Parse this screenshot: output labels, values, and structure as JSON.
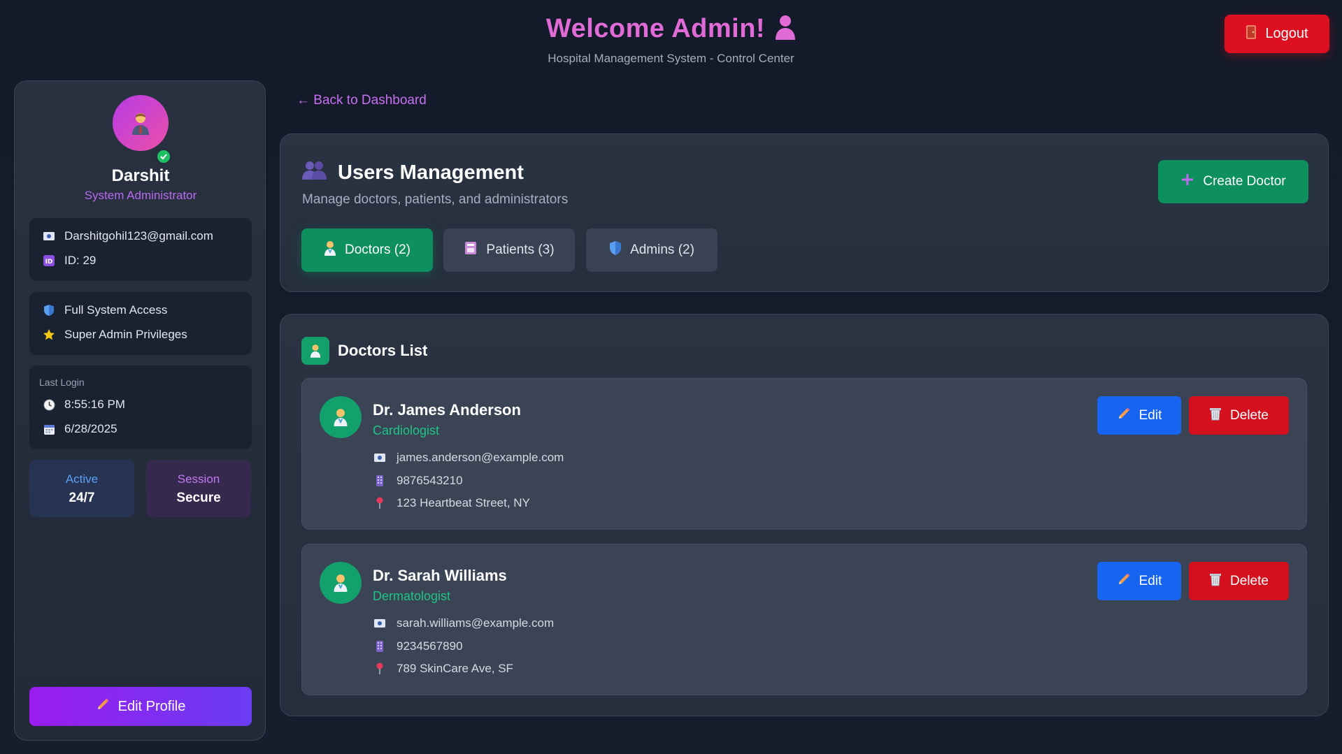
{
  "header": {
    "welcome": "Welcome Admin!",
    "subtitle": "Hospital Management System - Control Center",
    "logout_label": "Logout"
  },
  "sidebar": {
    "name": "Darshit",
    "role": "System Administrator",
    "email": "Darshitgohil123@gmail.com",
    "id": "ID: 29",
    "perms": [
      "Full System Access",
      "Super Admin Privileges"
    ],
    "last_login_label": "Last Login",
    "last_login_time": "8:55:16 PM",
    "last_login_date": "6/28/2025",
    "stat_active_label": "Active",
    "stat_active_value": "24/7",
    "stat_session_label": "Session",
    "stat_session_value": "Secure",
    "edit_profile_label": "Edit Profile"
  },
  "main": {
    "back_label": "← Back to Dashboard",
    "title": "Users Management",
    "subtitle": "Manage doctors, patients, and administrators",
    "create_label": "Create Doctor",
    "tabs": [
      {
        "label": "Doctors (2)",
        "active": true
      },
      {
        "label": "Patients (3)",
        "active": false
      },
      {
        "label": "Admins (2)",
        "active": false
      }
    ],
    "list_title": "Doctors List",
    "edit_label": "Edit",
    "delete_label": "Delete",
    "doctors": [
      {
        "name": "Dr. James Anderson",
        "specialty": "Cardiologist",
        "email": "james.anderson@example.com",
        "phone": "9876543210",
        "address": "123 Heartbeat Street, NY"
      },
      {
        "name": "Dr. Sarah Williams",
        "specialty": "Dermatologist",
        "email": "sarah.williams@example.com",
        "phone": "9234567890",
        "address": "789 SkinCare Ave, SF"
      }
    ]
  },
  "colors": {
    "accent_pink": "#e06ad6",
    "green": "#0d8f5e",
    "red": "#dc1020",
    "blue": "#1664f0",
    "purple": "#9a1cf0"
  }
}
